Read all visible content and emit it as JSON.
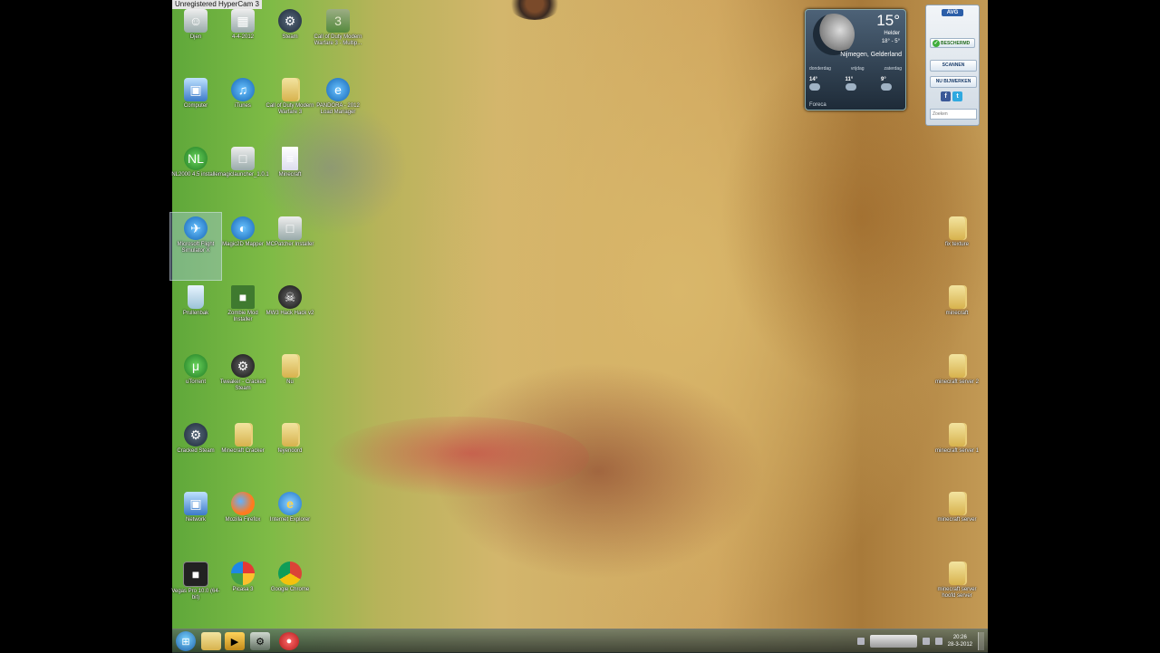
{
  "watermark": "Unregistered HyperCam 3",
  "desktop": {
    "icons_left": [
      {
        "label": "Djen",
        "glyph": "☺",
        "cls": "g-app",
        "name": "desktop-icon-djen"
      },
      {
        "label": "4-4-2012",
        "glyph": "▦",
        "cls": "g-app",
        "name": "desktop-icon-4-4-2012"
      },
      {
        "label": "Steam",
        "glyph": "⚙",
        "cls": "g-steam",
        "name": "desktop-icon-steam"
      },
      {
        "label": "Call of Duty Modern Warfare 3 - Multip...",
        "glyph": "3",
        "cls": "g-cod",
        "name": "desktop-icon-cod-mw3-multiplayer"
      },
      {
        "label": "Computer",
        "glyph": "▣",
        "cls": "g-pc",
        "name": "desktop-icon-computer"
      },
      {
        "label": "iTunes",
        "glyph": "♫",
        "cls": "g-blue",
        "name": "desktop-icon-itunes"
      },
      {
        "label": "Call of Duty Modern Warfare 3",
        "glyph": "",
        "cls": "g-folder",
        "name": "desktop-icon-cod-mw3"
      },
      {
        "label": "PANDORA - 2012 Load Manager",
        "glyph": "e",
        "cls": "g-blue",
        "name": "desktop-icon-pandora"
      },
      {
        "label": "NL2000 4.5 installer",
        "glyph": "NL",
        "cls": "g-green",
        "name": "desktop-icon-nl2000"
      },
      {
        "label": "magiclauncher_1.0.1",
        "glyph": "□",
        "cls": "g-app",
        "name": "desktop-icon-magiclauncher"
      },
      {
        "label": "Minecraft",
        "glyph": "≡",
        "cls": "g-doc",
        "name": "desktop-icon-minecraft"
      },
      {
        "label": "Microsoft Flight Simulator X",
        "glyph": "✈",
        "cls": "g-blue",
        "name": "desktop-icon-flight-simulator"
      },
      {
        "label": "Magic2D Mapper",
        "glyph": "◐",
        "cls": "g-blue",
        "name": "desktop-icon-magic2d"
      },
      {
        "label": "MCPatcher Installer",
        "glyph": "□",
        "cls": "g-app",
        "name": "desktop-icon-mcpatcher"
      },
      {
        "label": "Prullenbak",
        "glyph": "",
        "cls": "g-bin",
        "name": "desktop-icon-recycle-bin"
      },
      {
        "label": "Zombie Mod Installer",
        "glyph": "■",
        "cls": "g-zombie",
        "name": "desktop-icon-zombie-mod"
      },
      {
        "label": "MW3 Hack Hack v2",
        "glyph": "☠",
        "cls": "g-dark",
        "name": "desktop-icon-mw3-hack"
      },
      {
        "label": "uTorrent",
        "glyph": "μ",
        "cls": "g-green",
        "name": "desktop-icon-utorrent"
      },
      {
        "label": "Tweaker - Cracked Steam",
        "glyph": "⚙",
        "cls": "g-dark",
        "name": "desktop-icon-tweaker"
      },
      {
        "label": "Nu",
        "glyph": "",
        "cls": "g-folder",
        "name": "desktop-icon-folder-nu"
      },
      {
        "label": "Cracked Steam",
        "glyph": "⚙",
        "cls": "g-steam",
        "name": "desktop-icon-cracked-steam"
      },
      {
        "label": "Minecraft Cracker",
        "glyph": "",
        "cls": "g-folder",
        "name": "desktop-icon-minecraft-cracker"
      },
      {
        "label": "feyenoord",
        "glyph": "",
        "cls": "g-folder",
        "name": "desktop-icon-feyenoord"
      },
      {
        "label": "Network",
        "glyph": "▣",
        "cls": "g-pc",
        "name": "desktop-icon-network"
      },
      {
        "label": "Mozilla Firefox",
        "glyph": "",
        "cls": "g-firefox",
        "name": "desktop-icon-firefox"
      },
      {
        "label": "Internet Explorer",
        "glyph": "e",
        "cls": "g-ie",
        "name": "desktop-icon-internet-explorer"
      },
      {
        "label": "Vegas Pro 10.0 (64-bit)",
        "glyph": "■",
        "cls": "g-vegas",
        "name": "desktop-icon-vegas-pro"
      },
      {
        "label": "Picasa 3",
        "glyph": "",
        "cls": "g-picasa",
        "name": "desktop-icon-picasa"
      },
      {
        "label": "Google Chrome",
        "glyph": "",
        "cls": "g-chrome",
        "name": "desktop-icon-chrome"
      }
    ],
    "icons_right": [
      {
        "label": "fix texture",
        "name": "desktop-folder-fix-texture"
      },
      {
        "label": "minecraft",
        "name": "desktop-folder-minecraft"
      },
      {
        "label": "minecraft server 2",
        "name": "desktop-folder-minecraft-server-2"
      },
      {
        "label": "minecraft server 1",
        "name": "desktop-folder-minecraft-server-1"
      },
      {
        "label": "minecraft server",
        "name": "desktop-folder-minecraft-server"
      },
      {
        "label": "minecraft server hoofd server",
        "name": "desktop-folder-minecraft-server-hoofd"
      }
    ]
  },
  "weather": {
    "temp": "15°",
    "condition": "Helder",
    "hilo": "18° - 5°",
    "location": "Nijmegen, Gelderland",
    "days": [
      "donderdag",
      "vrijdag",
      "zaterdag"
    ],
    "forecast": [
      "14°",
      "11°",
      "9°"
    ],
    "brand": "Foreca"
  },
  "avg": {
    "logo": "AVG",
    "status": "BESCHERMD",
    "scan": "SCANNEN",
    "update": "NU BIJWERKEN",
    "search_placeholder": "Zoeken"
  },
  "taskbar": {
    "time": "20:26",
    "date": "28-3-2012"
  }
}
